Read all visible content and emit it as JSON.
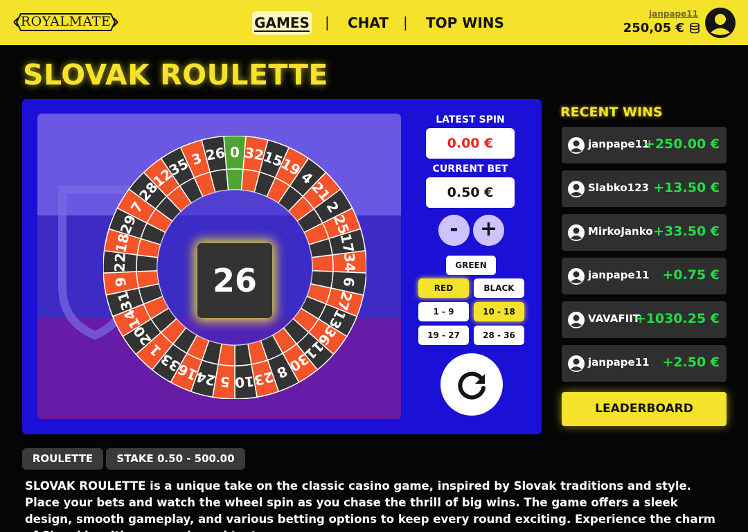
{
  "header": {
    "logo": "ROYALMATE",
    "nav": [
      {
        "label": "GAMES",
        "active": true
      },
      {
        "label": "CHAT",
        "active": false
      },
      {
        "label": "TOP WINS",
        "active": false
      }
    ],
    "nav_separator": "|",
    "username": "janpape11",
    "balance": "250,05 €",
    "icons": [
      "coins-icon",
      "user-avatar-icon"
    ]
  },
  "page_title": "SLOVAK ROULETTE",
  "game": {
    "wheel_numbers": [
      0,
      32,
      15,
      19,
      4,
      21,
      2,
      25,
      17,
      34,
      6,
      27,
      13,
      36,
      11,
      30,
      8,
      23,
      10,
      5,
      24,
      16,
      33,
      1,
      20,
      14,
      31,
      9,
      22,
      18,
      29,
      7,
      28,
      12,
      35,
      3,
      26
    ],
    "result_number": "26",
    "latest_spin_label": "LATEST SPIN",
    "latest_spin_value": "0.00 €",
    "current_bet_label": "CURRENT BET",
    "current_bet_value": "0.50 €",
    "minus_label": "-",
    "plus_label": "+",
    "bet_options": {
      "green": "GREEN",
      "red": "RED",
      "black": "BLACK",
      "range_1": "1 - 9",
      "range_2": "10 - 18",
      "range_3": "19 - 27",
      "range_4": "28 - 36"
    },
    "active_bets": [
      "RED",
      "10 - 18"
    ],
    "spin_icon": "spin-icon",
    "colors": {
      "red": "#f4542a",
      "black": "#333333",
      "green": "#4fa533",
      "accent": "#f5e22a",
      "panel": "#1a10d6"
    }
  },
  "recent_wins": {
    "title": "RECENT WINS",
    "items": [
      {
        "user": "janpape11",
        "amount": "+250.00 €"
      },
      {
        "user": "Slabko123",
        "amount": "+13.50 €"
      },
      {
        "user": "MirkoJanko",
        "amount": "+33.50 €"
      },
      {
        "user": "janpape11",
        "amount": "+0.75 €"
      },
      {
        "user": "VAVAFIIT",
        "amount": "+1030.25 €"
      },
      {
        "user": "janpape11",
        "amount": "+2.50 €"
      }
    ],
    "leaderboard_label": "LEADERBOARD"
  },
  "tags": [
    "ROULETTE",
    "STAKE 0.50 - 500.00"
  ],
  "description": "SLOVAK ROULETTE is a unique take on the classic casino game, inspired by Slovak traditions and style. Place your bets and watch the wheel spin as you chase the thrill of big wins. The game offers a sleek design, smooth gameplay, and various betting options to keep every round exciting. Experience the charm of Slovakia with every spin and test your"
}
